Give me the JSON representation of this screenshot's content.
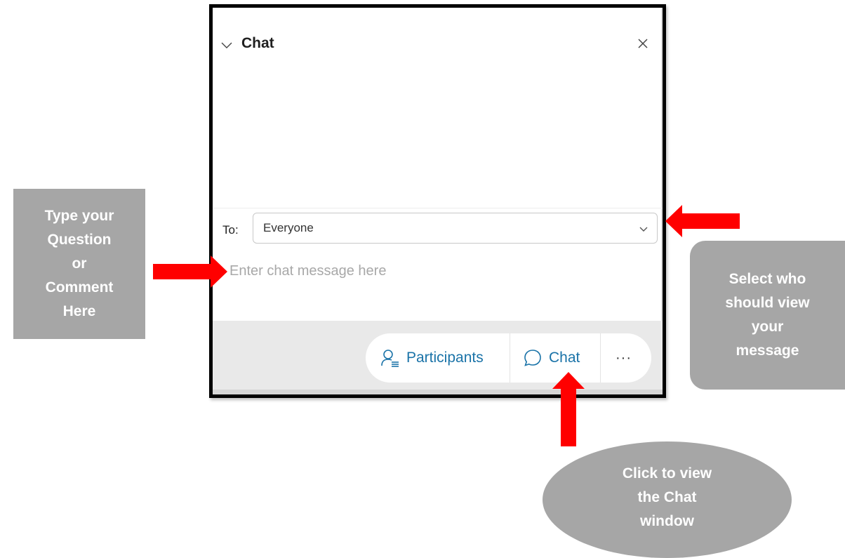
{
  "chat_panel": {
    "title": "Chat",
    "to_label": "To:",
    "recipient": "Everyone",
    "message_placeholder": "Enter chat message here",
    "toolbar": {
      "participants_label": "Participants",
      "chat_label": "Chat",
      "more_label": "···"
    }
  },
  "annotations": {
    "left": [
      "Type your",
      "Question",
      "or",
      "Comment",
      "Here"
    ],
    "right": [
      "Select who",
      "should view",
      "your",
      "message"
    ],
    "bottom": [
      "Click to view",
      "the Chat",
      "window"
    ]
  },
  "colors": {
    "arrow": "#ff0000",
    "callout_bg": "#a6a6a6",
    "accent": "#1a73a8"
  }
}
